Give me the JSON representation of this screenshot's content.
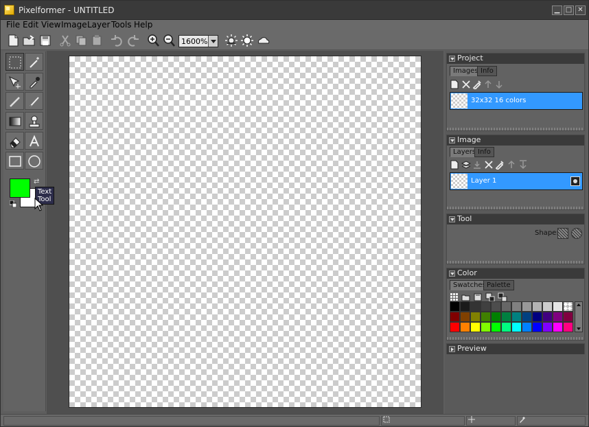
{
  "window": {
    "title": "Pixelformer - UNTITLED"
  },
  "window_controls": {
    "minimize": "▁",
    "maximize": "□",
    "close": "✕"
  },
  "menu": [
    {
      "label": "File",
      "underline": "F"
    },
    {
      "label": "Edit",
      "underline": "E"
    },
    {
      "label": "View",
      "underline": "V"
    },
    {
      "label": "Image",
      "underline": "I"
    },
    {
      "label": "Layer",
      "underline": "L"
    },
    {
      "label": "Tools",
      "underline": "T"
    },
    {
      "label": "Help",
      "underline": "H"
    }
  ],
  "toolbar": {
    "zoom": "1600%",
    "buttons": [
      "new-icon",
      "open-icon",
      "save-icon",
      "cut-icon",
      "copy-icon",
      "paste-icon",
      "undo-icon",
      "redo-icon",
      "zoom-in-icon",
      "zoom-out-icon",
      "brightness-icon",
      "sun-icon",
      "cloud-icon"
    ]
  },
  "tools": {
    "items": [
      "marquee-icon",
      "magic-wand-icon",
      "move-icon",
      "eyedropper-icon",
      "pencil-icon",
      "brush-icon",
      "gradient-icon",
      "stamp-icon",
      "eraser-icon",
      "text-icon",
      "rectangle-icon",
      "ellipse-icon"
    ],
    "tooltip": "Text Tool",
    "foreground_color": "#00ff00",
    "background_color": "#ffffff"
  },
  "project_panel": {
    "title": "Project",
    "tabs": [
      "Images",
      "Info"
    ],
    "items": [
      {
        "label": "32x32 16 colors"
      }
    ]
  },
  "image_panel": {
    "title": "Image",
    "tabs": [
      "Layers",
      "Info"
    ],
    "layers": [
      {
        "label": "Layer 1"
      }
    ]
  },
  "tool_panel": {
    "title": "Tool",
    "shape_label": "Shape:"
  },
  "color_panel": {
    "title": "Color",
    "tabs": [
      "Swatches",
      "Palette"
    ],
    "swatches": [
      "#000000",
      "#1a1a1a",
      "#333333",
      "#404040",
      "#4d4d4d",
      "#666666",
      "#808080",
      "#999999",
      "#b3b3b3",
      "#cccccc",
      "#e6e6e6",
      "transparent",
      "#800000",
      "#804000",
      "#808000",
      "#408000",
      "#008000",
      "#008040",
      "#008080",
      "#004080",
      "#000080",
      "#400080",
      "#800080",
      "#800040",
      "#ff0000",
      "#ff8000",
      "#ffff00",
      "#80ff00",
      "#00ff00",
      "#00ff80",
      "#00ffff",
      "#0080ff",
      "#0000ff",
      "#8000ff",
      "#ff00ff",
      "#ff0080"
    ]
  },
  "preview_panel": {
    "title": "Preview"
  },
  "statusbar": {
    "cells": [
      "",
      "",
      "",
      ""
    ]
  }
}
